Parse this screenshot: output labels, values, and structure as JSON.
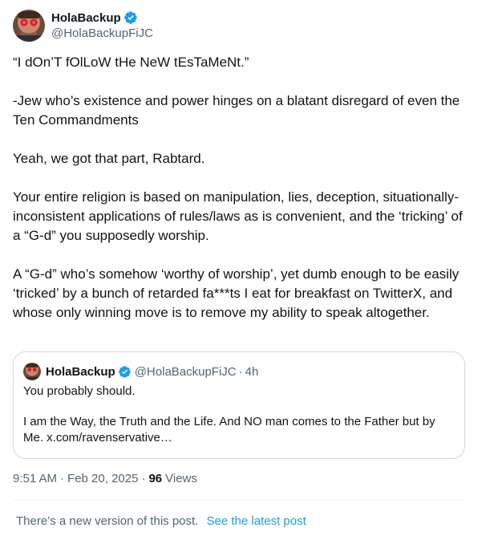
{
  "author": {
    "display_name": "HolaBackup",
    "handle": "@HolaBackupFiJC",
    "avatar_icon": "profile-avatar-red-eyes",
    "verified_icon": "verified-badge-icon"
  },
  "post": {
    "paragraphs": [
      "“I dOn’T fOlLoW tHe NeW tEsTaMeNt.”",
      "-Jew who’s existence and power hinges on a blatant disregard of even the Ten Commandments",
      "Yeah, we got that part, Rabtard.",
      "Your entire religion is based on manipulation, lies, deception, situationally-inconsistent applications of rules/laws as is convenient, and the ‘tricking’ of a “G-d” you supposedly worship.",
      "A “G-d” who’s somehow ‘worthy of worship’, yet dumb enough to be easily ‘tricked’ by a bunch of retarded fa***ts I eat for breakfast on TwitterX, and whose only winning move is to remove my ability to speak altogether."
    ]
  },
  "quoted_post": {
    "display_name": "HolaBackup",
    "handle": "@HolaBackupFiJC",
    "separator": "·",
    "time": "4h",
    "paragraphs": [
      "You probably should.",
      "I am the Way, the Truth and the Life. And NO man comes to the Father but by Me. x.com/ravenservative…"
    ]
  },
  "meta": {
    "time": "9:51 AM",
    "separator": "·",
    "date": "Feb 20, 2025",
    "views_count": "96",
    "views_label": "Views"
  },
  "notice": {
    "text": "There’s a new version of this post.",
    "link_label": "See the latest post"
  },
  "colors": {
    "text_primary": "#0f1419",
    "text_secondary": "#536471",
    "accent": "#1d9bf0",
    "border": "#cfd9de"
  }
}
